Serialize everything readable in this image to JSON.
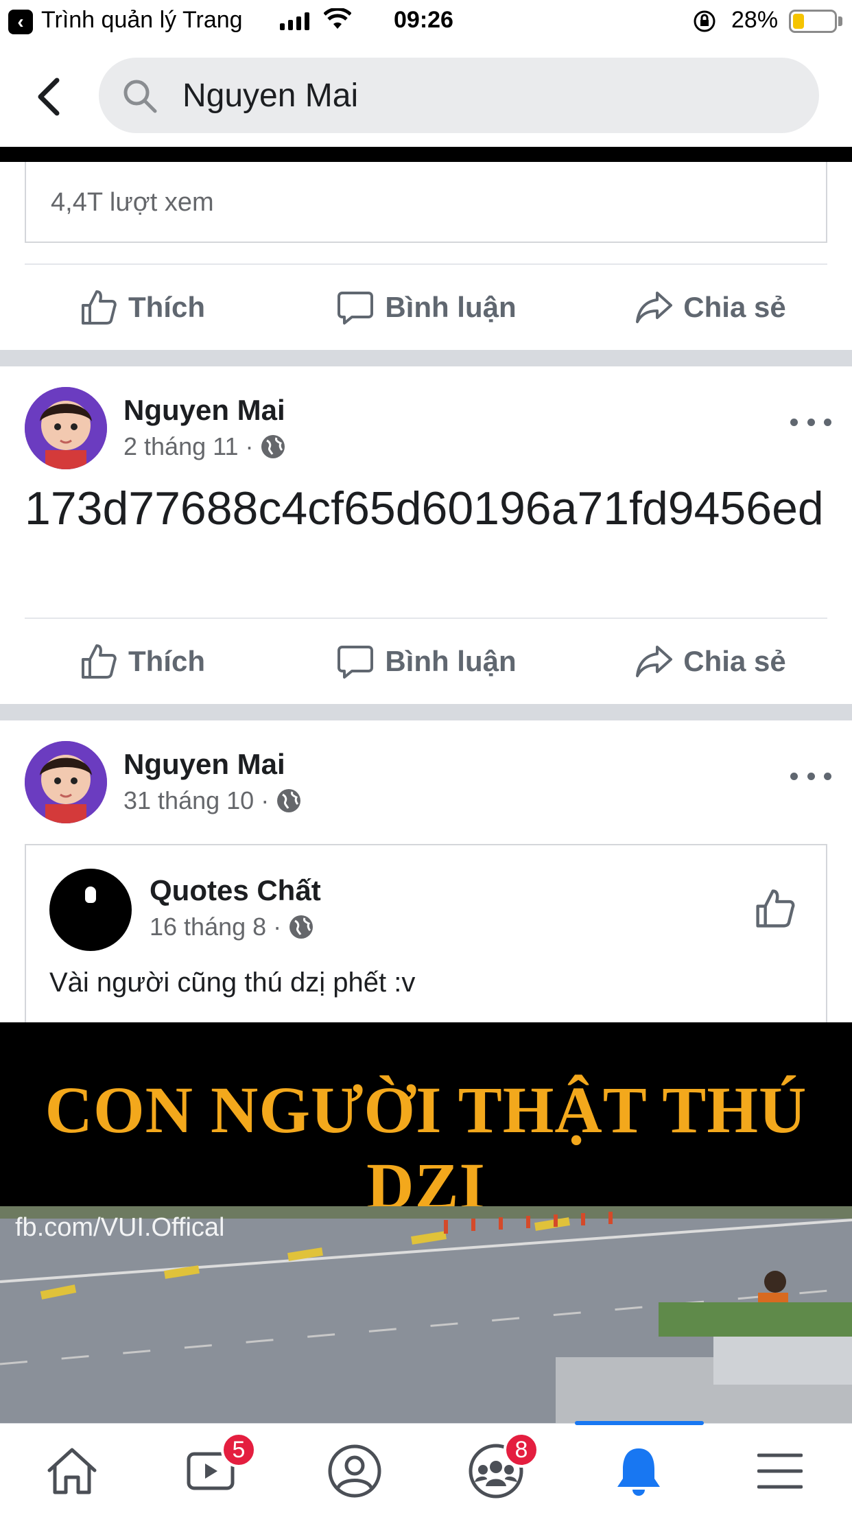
{
  "status_bar": {
    "back_app": "Trình quản lý Trang",
    "time": "09:26",
    "battery": "28%",
    "battery_level": 0.28
  },
  "search": {
    "back_icon": "chevron-left-icon",
    "query": "Nguyen Mai"
  },
  "feed": {
    "prev_post": {
      "views": "4,4T lượt xem",
      "actions": {
        "like": "Thích",
        "comment": "Bình luận",
        "share": "Chia sẻ"
      }
    },
    "post1": {
      "author": "Nguyen Mai",
      "date": "2 tháng 11",
      "text": "173d77688c4cf65d60196a71fd9456ed",
      "actions": {
        "like": "Thích",
        "comment": "Bình luận",
        "share": "Chia sẻ"
      }
    },
    "post2": {
      "author": "Nguyen Mai",
      "date": "31 tháng 10",
      "shared": {
        "author": "Quotes Chất",
        "date": "16 tháng 8",
        "text": "Vài người cũng thú dzị phết :v"
      },
      "video": {
        "title": "CON NGƯỜI THẬT THÚ DZỊ",
        "watermark": "fb.com/VUI.Offical"
      }
    }
  },
  "tabbar": {
    "items": [
      "home-icon",
      "watch-icon",
      "profile-icon",
      "groups-icon",
      "notifications-icon",
      "menu-icon"
    ],
    "watch_badge": "5",
    "groups_badge": "8",
    "active": "notifications-icon",
    "accent": "#1877f2"
  }
}
